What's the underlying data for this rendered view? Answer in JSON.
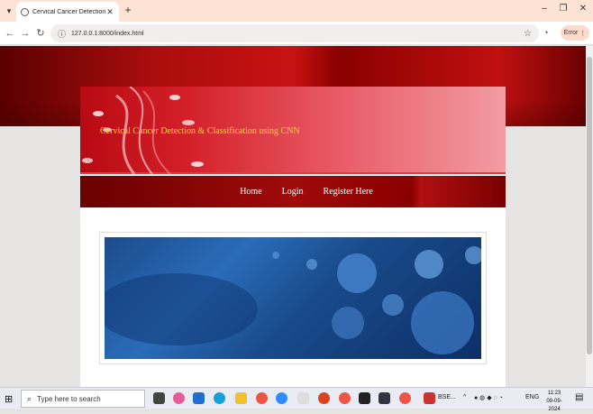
{
  "browser": {
    "tab_title": "Cervical Cancer Detection",
    "url": "127.0.0.1:8000/index.html",
    "error_label": "Error"
  },
  "site": {
    "title": "Cervical Cancer Detection & Classification using CNN",
    "nav": [
      "Home",
      "Login",
      "Register Here"
    ]
  },
  "taskbar": {
    "search_placeholder": "Type here to search",
    "pinned_label": "BSE...",
    "lang": "ENG",
    "time": "11:23",
    "date": "09-09-2024"
  },
  "colors": {
    "header_red": "#d42028",
    "title_gold": "#f6d23c",
    "nav_dark_red": "#a00a0a"
  }
}
